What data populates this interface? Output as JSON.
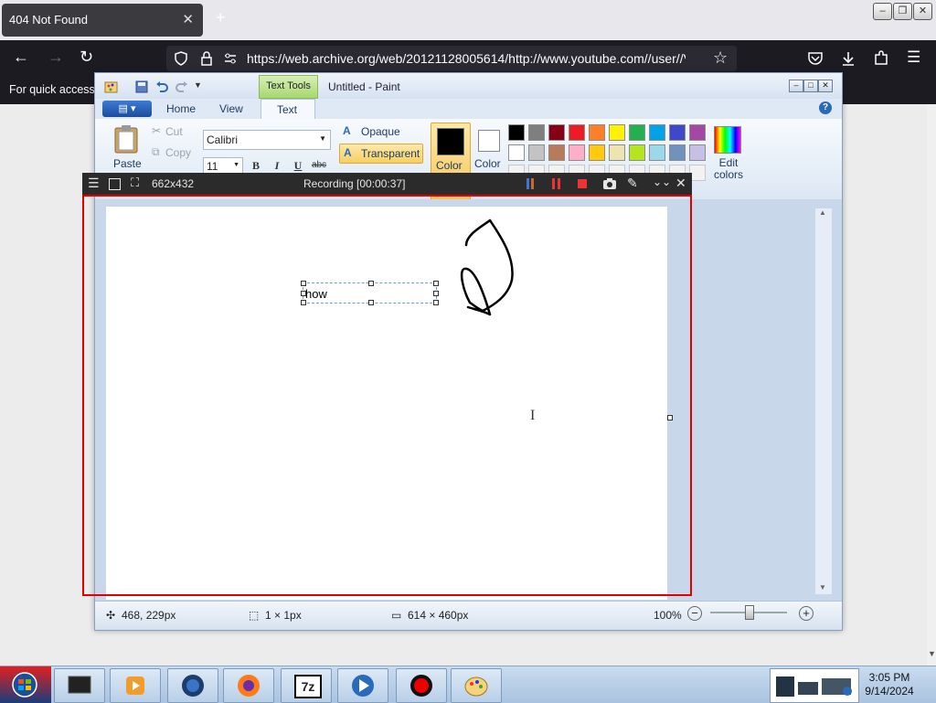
{
  "browser": {
    "tab_title": "404 Not Found",
    "tab_close": "✕",
    "new_tab": "+",
    "url": "https://web.archive.org/web/20121128005614/http://www.youtube.com//user//V",
    "bookmarks_text": "For quick access, ",
    "window_minimize": "–",
    "window_restore": "❐",
    "window_close": "✕"
  },
  "paint": {
    "context_tab": "Text Tools",
    "title": "Untitled - Paint",
    "file_menu": "▤ ▾",
    "tabs": [
      "Home",
      "View",
      "Text"
    ],
    "clipboard": {
      "paste": "Paste",
      "cut": "Cut",
      "copy": "Copy"
    },
    "font": {
      "name": "Calibri",
      "size": "11",
      "bold": "B",
      "italic": "I",
      "underline": "U",
      "strike": "abc"
    },
    "background": {
      "opaque": "Opaque",
      "transparent": "Transparent"
    },
    "color1_label": "Color",
    "color2_label": "Color",
    "edit_colors": "Edit colors",
    "palette_row1": [
      "#000000",
      "#7f7f7f",
      "#880015",
      "#ed1c24",
      "#ff7f27",
      "#fff200",
      "#22b14c",
      "#00a2e8",
      "#3f48cc",
      "#a349a4"
    ],
    "palette_row2": [
      "#ffffff",
      "#c3c3c3",
      "#b97a57",
      "#ffaec9",
      "#ffc90e",
      "#efe4b0",
      "#b5e61d",
      "#99d9ea",
      "#7092be",
      "#c8bfe7"
    ],
    "canvas_text": "how",
    "status": {
      "cursor_pos": "468, 229px",
      "selection": "1 × 1px",
      "canvas_size": "614 × 460px",
      "zoom": "100%"
    }
  },
  "recorder": {
    "size": "662x432",
    "status": "Recording [00:00:37]"
  },
  "taskbar": {
    "time": "3:05 PM",
    "date": "9/14/2024"
  }
}
